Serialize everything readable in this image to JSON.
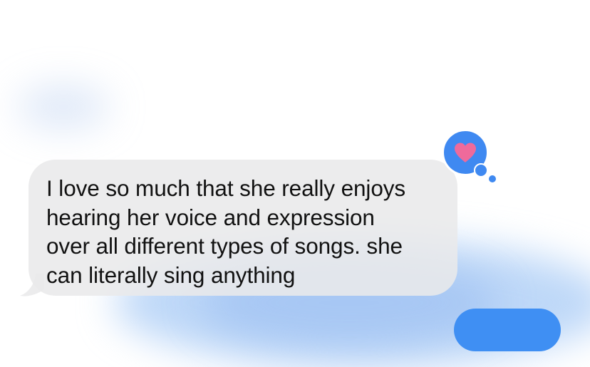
{
  "message": {
    "text_lines": [
      "I love so much that she really enjoys",
      "hearing her voice and expression",
      "over all different types of songs. she",
      "can literally sing anything"
    ]
  },
  "reaction": {
    "icon": "heart-icon",
    "badge_color": "#3f89f1",
    "heart_color": "#ef6a9b"
  },
  "colors": {
    "incoming_bubble": "#e9e9eb",
    "outgoing_bubble": "#3f8ff3",
    "text": "#111111"
  }
}
